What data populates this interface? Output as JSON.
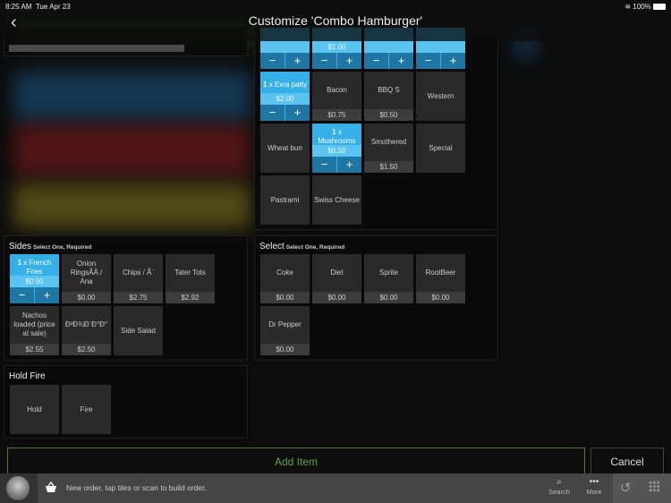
{
  "status": {
    "time": "8:25 AM",
    "date": "Tue Apr 23",
    "battery": "100%"
  },
  "header": {
    "title": "Customize 'Combo Hamburger'"
  },
  "toppings": {
    "tiles": [
      {
        "name": "",
        "price": "",
        "selected": true
      },
      {
        "name": "",
        "price": "$1.00",
        "selected": true
      },
      {
        "name": "",
        "price": "",
        "selected": true
      },
      {
        "name": "",
        "price": "",
        "selected": true
      },
      {
        "qty": "1",
        "name": "x Exra patty",
        "price": "$2.00",
        "selected": true
      },
      {
        "name": "Bacon",
        "price": "$0.75"
      },
      {
        "name": "BBQ S",
        "price": "$0.50"
      },
      {
        "name": "Western",
        "price": ""
      },
      {
        "name": "Wheat bun",
        "price": ""
      },
      {
        "qty": "1",
        "name": "x Mushrooms",
        "price": "$0.50",
        "selected": true
      },
      {
        "name": "Smothered",
        "price": "$1.50"
      },
      {
        "name": "Special",
        "price": ""
      },
      {
        "name": "Pastrami",
        "price": ""
      },
      {
        "name": "Swiss Cheese",
        "price": ""
      }
    ]
  },
  "sides": {
    "title": "Sides",
    "subtitle": "Select One, Required",
    "tiles": [
      {
        "qty": "1",
        "name": "x French Fries",
        "price": "$0.50",
        "selected": true
      },
      {
        "name": "Onion RingsÃÂ / Ana",
        "price": "$0.00"
      },
      {
        "name": "Chips / Ã¨",
        "price": "$2.75"
      },
      {
        "name": "Tater Tots",
        "price": "$2.92"
      },
      {
        "name": "Nachos loaded (price at sale)",
        "price": "$2.55"
      },
      {
        "name": "Ð²Ð¾Ð´Ð°Ð°",
        "price": "$2.50"
      },
      {
        "name": "Side Salad",
        "price": ""
      }
    ]
  },
  "select": {
    "title": "Select",
    "subtitle": "Select One, Required",
    "tiles": [
      {
        "name": "Coke",
        "price": "$0.00"
      },
      {
        "name": "Diet",
        "price": "$0.00"
      },
      {
        "name": "Sprite",
        "price": "$0.00"
      },
      {
        "name": "RootBeer",
        "price": "$0.00"
      },
      {
        "name": "Dr Pepper",
        "price": "$0.00"
      }
    ]
  },
  "holdfire": {
    "title": "Hold Fire",
    "tiles": [
      {
        "name": "Hold",
        "price": ""
      },
      {
        "name": "Fire",
        "price": ""
      }
    ]
  },
  "actions": {
    "add": "Add Item",
    "cancel": "Cancel"
  },
  "bottom": {
    "message": "New order, tap tiles or scan to build order.",
    "search": "Search",
    "more": "More"
  },
  "colors": {
    "selected": "#34b0e6",
    "add_border": "#4d7a2c"
  }
}
